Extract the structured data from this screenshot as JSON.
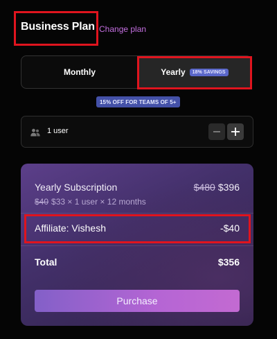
{
  "header": {
    "title": "Business Plan",
    "change_plan": "Change plan"
  },
  "billing_toggle": {
    "monthly_label": "Monthly",
    "yearly_label": "Yearly",
    "yearly_badge": "18% SAVINGS",
    "selected": "Yearly"
  },
  "team_discount_badge": "15% OFF FOR TEAMS OF 5+",
  "users": {
    "label": "1 user",
    "count": 1,
    "icon": "users-icon"
  },
  "summary": {
    "subscription_title": "Yearly Subscription",
    "original_price": "$480",
    "price": "$396",
    "detail_original": "$40",
    "detail_price": "$33",
    "detail_rest": "× 1 user × 12 months",
    "affiliate_label": "Affiliate: Vishesh",
    "affiliate_value": "-$40",
    "total_label": "Total",
    "total_value": "$356",
    "purchase_label": "Purchase"
  },
  "colors": {
    "accent_link": "#c46fe0",
    "badge": "#4451a8",
    "highlight": "#e0141e",
    "purchase_gradient_start": "#8360c8",
    "purchase_gradient_end": "#c36ad2"
  }
}
